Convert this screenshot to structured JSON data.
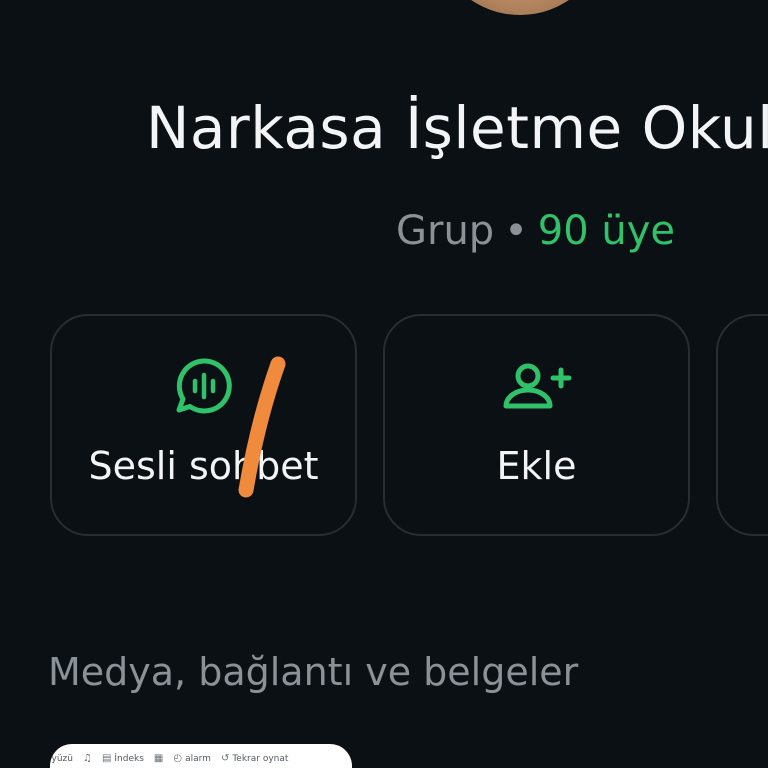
{
  "group": {
    "name": "Narkasa İşletme Okulu",
    "kind": "Grup",
    "separator": "•",
    "members": "90 üye"
  },
  "actions": [
    {
      "label": "Sesli sohbet",
      "icon": "voice-chat-icon"
    },
    {
      "label": "Ekle",
      "icon": "add-person-icon"
    },
    {
      "label": "",
      "icon": "more-icon"
    }
  ],
  "media_section": {
    "heading": "Medya, bağlantı ve belgeler",
    "toolbar": [
      {
        "label": "ayüzü",
        "icon": "view-icon"
      },
      {
        "label": "",
        "icon": "audio-icon"
      },
      {
        "label": "İndeks",
        "icon": "index-icon"
      },
      {
        "label": "",
        "icon": "grid-icon"
      },
      {
        "label": "alarm",
        "icon": "alarm-icon"
      },
      {
        "label": "Tekrar oynat",
        "icon": "replay-icon"
      }
    ]
  },
  "colors": {
    "background": "#0b1014",
    "accent": "#2fc26a",
    "muted_text": "#8a9197",
    "card_border": "#262e34",
    "annotation": "#f08a3c"
  }
}
